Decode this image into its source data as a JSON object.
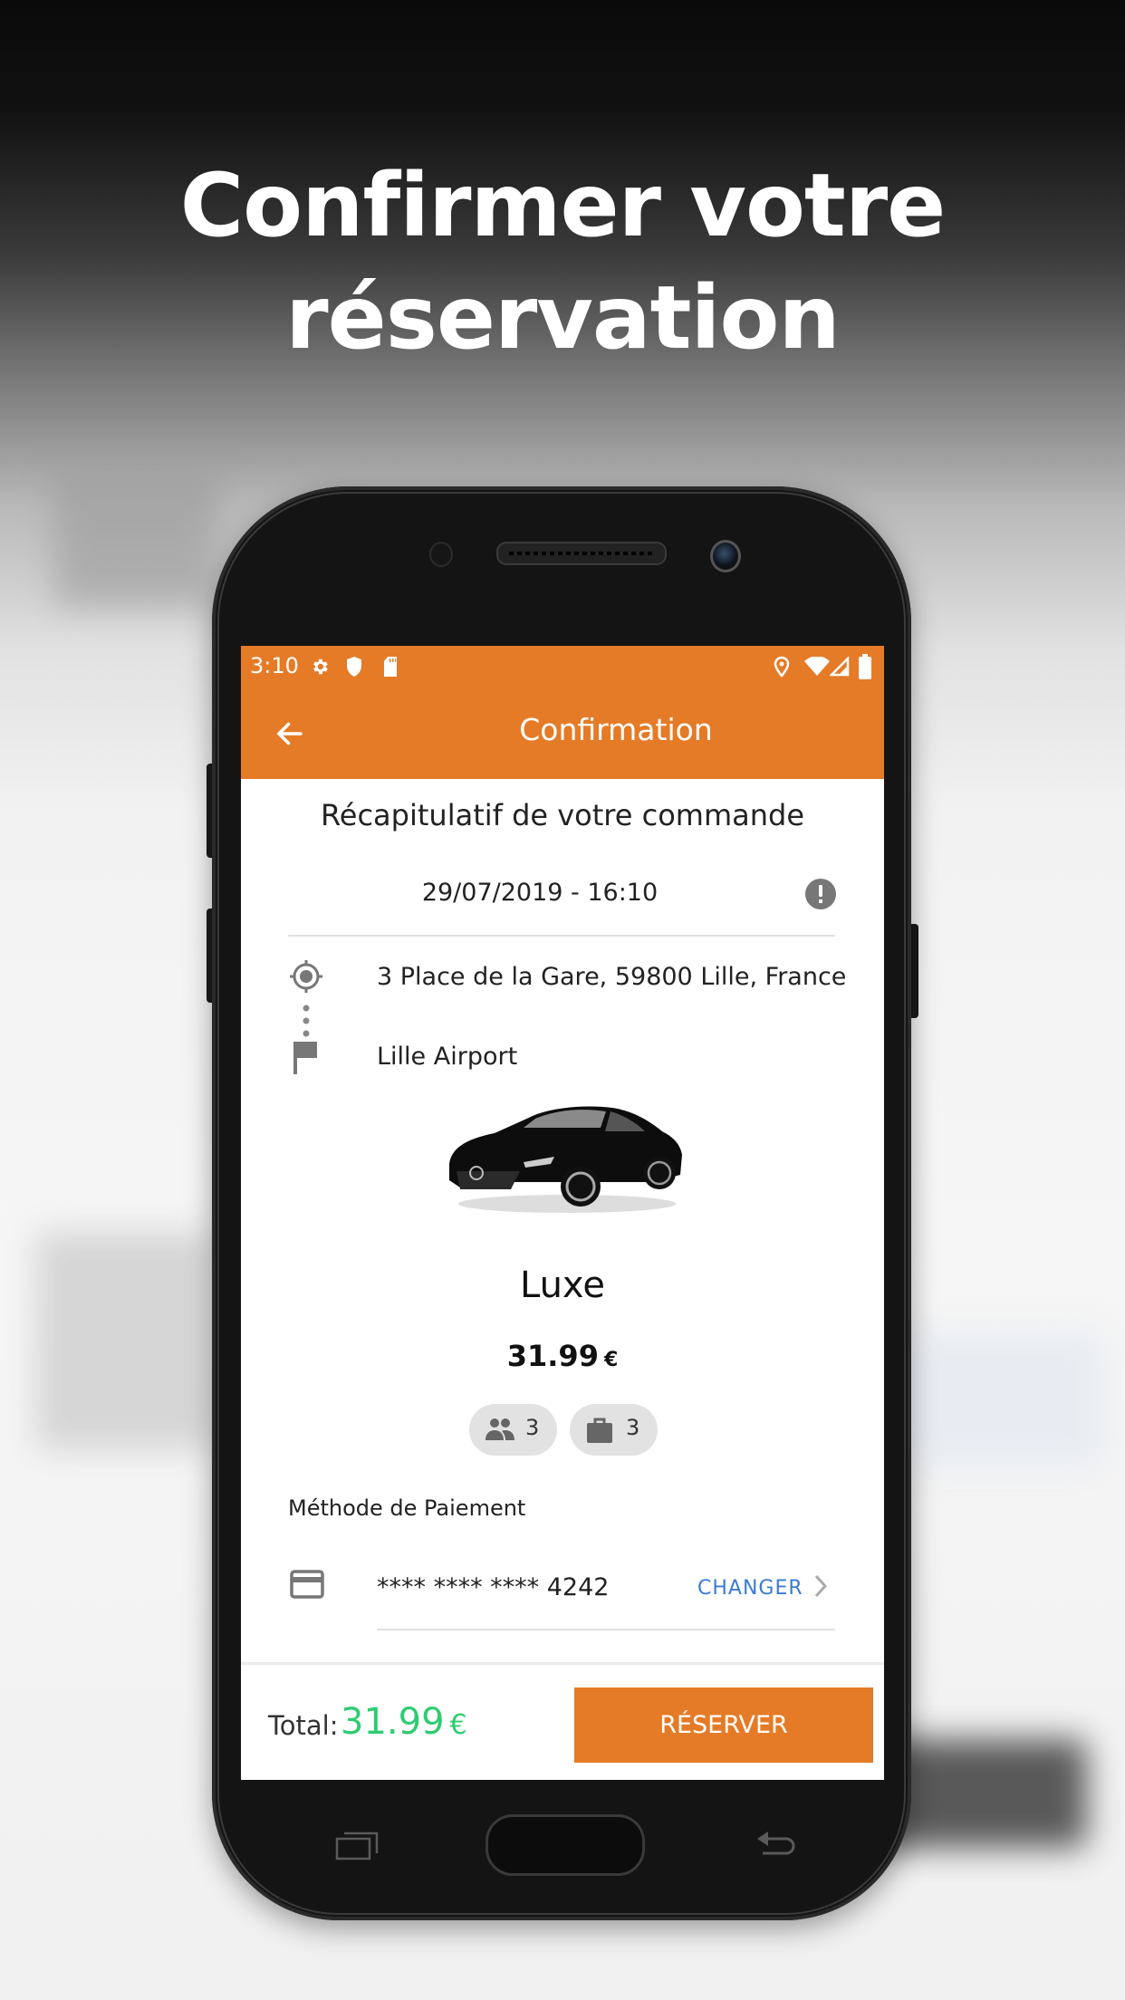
{
  "headline": {
    "line1": "Confirmer votre",
    "line2": "réservation"
  },
  "status_bar": {
    "time": "3:10",
    "left_icons": [
      "gear-icon",
      "shield-icon",
      "sd-card-icon"
    ],
    "right_icons": [
      "location-icon",
      "wifi-icon",
      "signal-icon",
      "battery-icon"
    ]
  },
  "app_bar": {
    "title": "Confirmation",
    "back_icon": "arrow-left-icon"
  },
  "summary": {
    "title": "Récapitulatif de votre commande",
    "datetime": "29/07/2019 - 16:10",
    "pickup": "3 Place de la Gare, 59800 Lille, France",
    "dropoff": "Lille Airport"
  },
  "vehicle": {
    "category": "Luxe",
    "price": "31.99",
    "currency": "€",
    "passengers": "3",
    "luggage": "3"
  },
  "payment": {
    "label": "Méthode de Paiement",
    "card_number": "**** **** **** 4242",
    "change_label": "CHANGER"
  },
  "footer": {
    "total_label": "Total:",
    "total_value": "31.99",
    "currency": "€",
    "reserve_label": "RÉSERVER"
  },
  "colors": {
    "brand": "#e57b27",
    "total": "#2ecc71",
    "link": "#3a7bd5"
  }
}
